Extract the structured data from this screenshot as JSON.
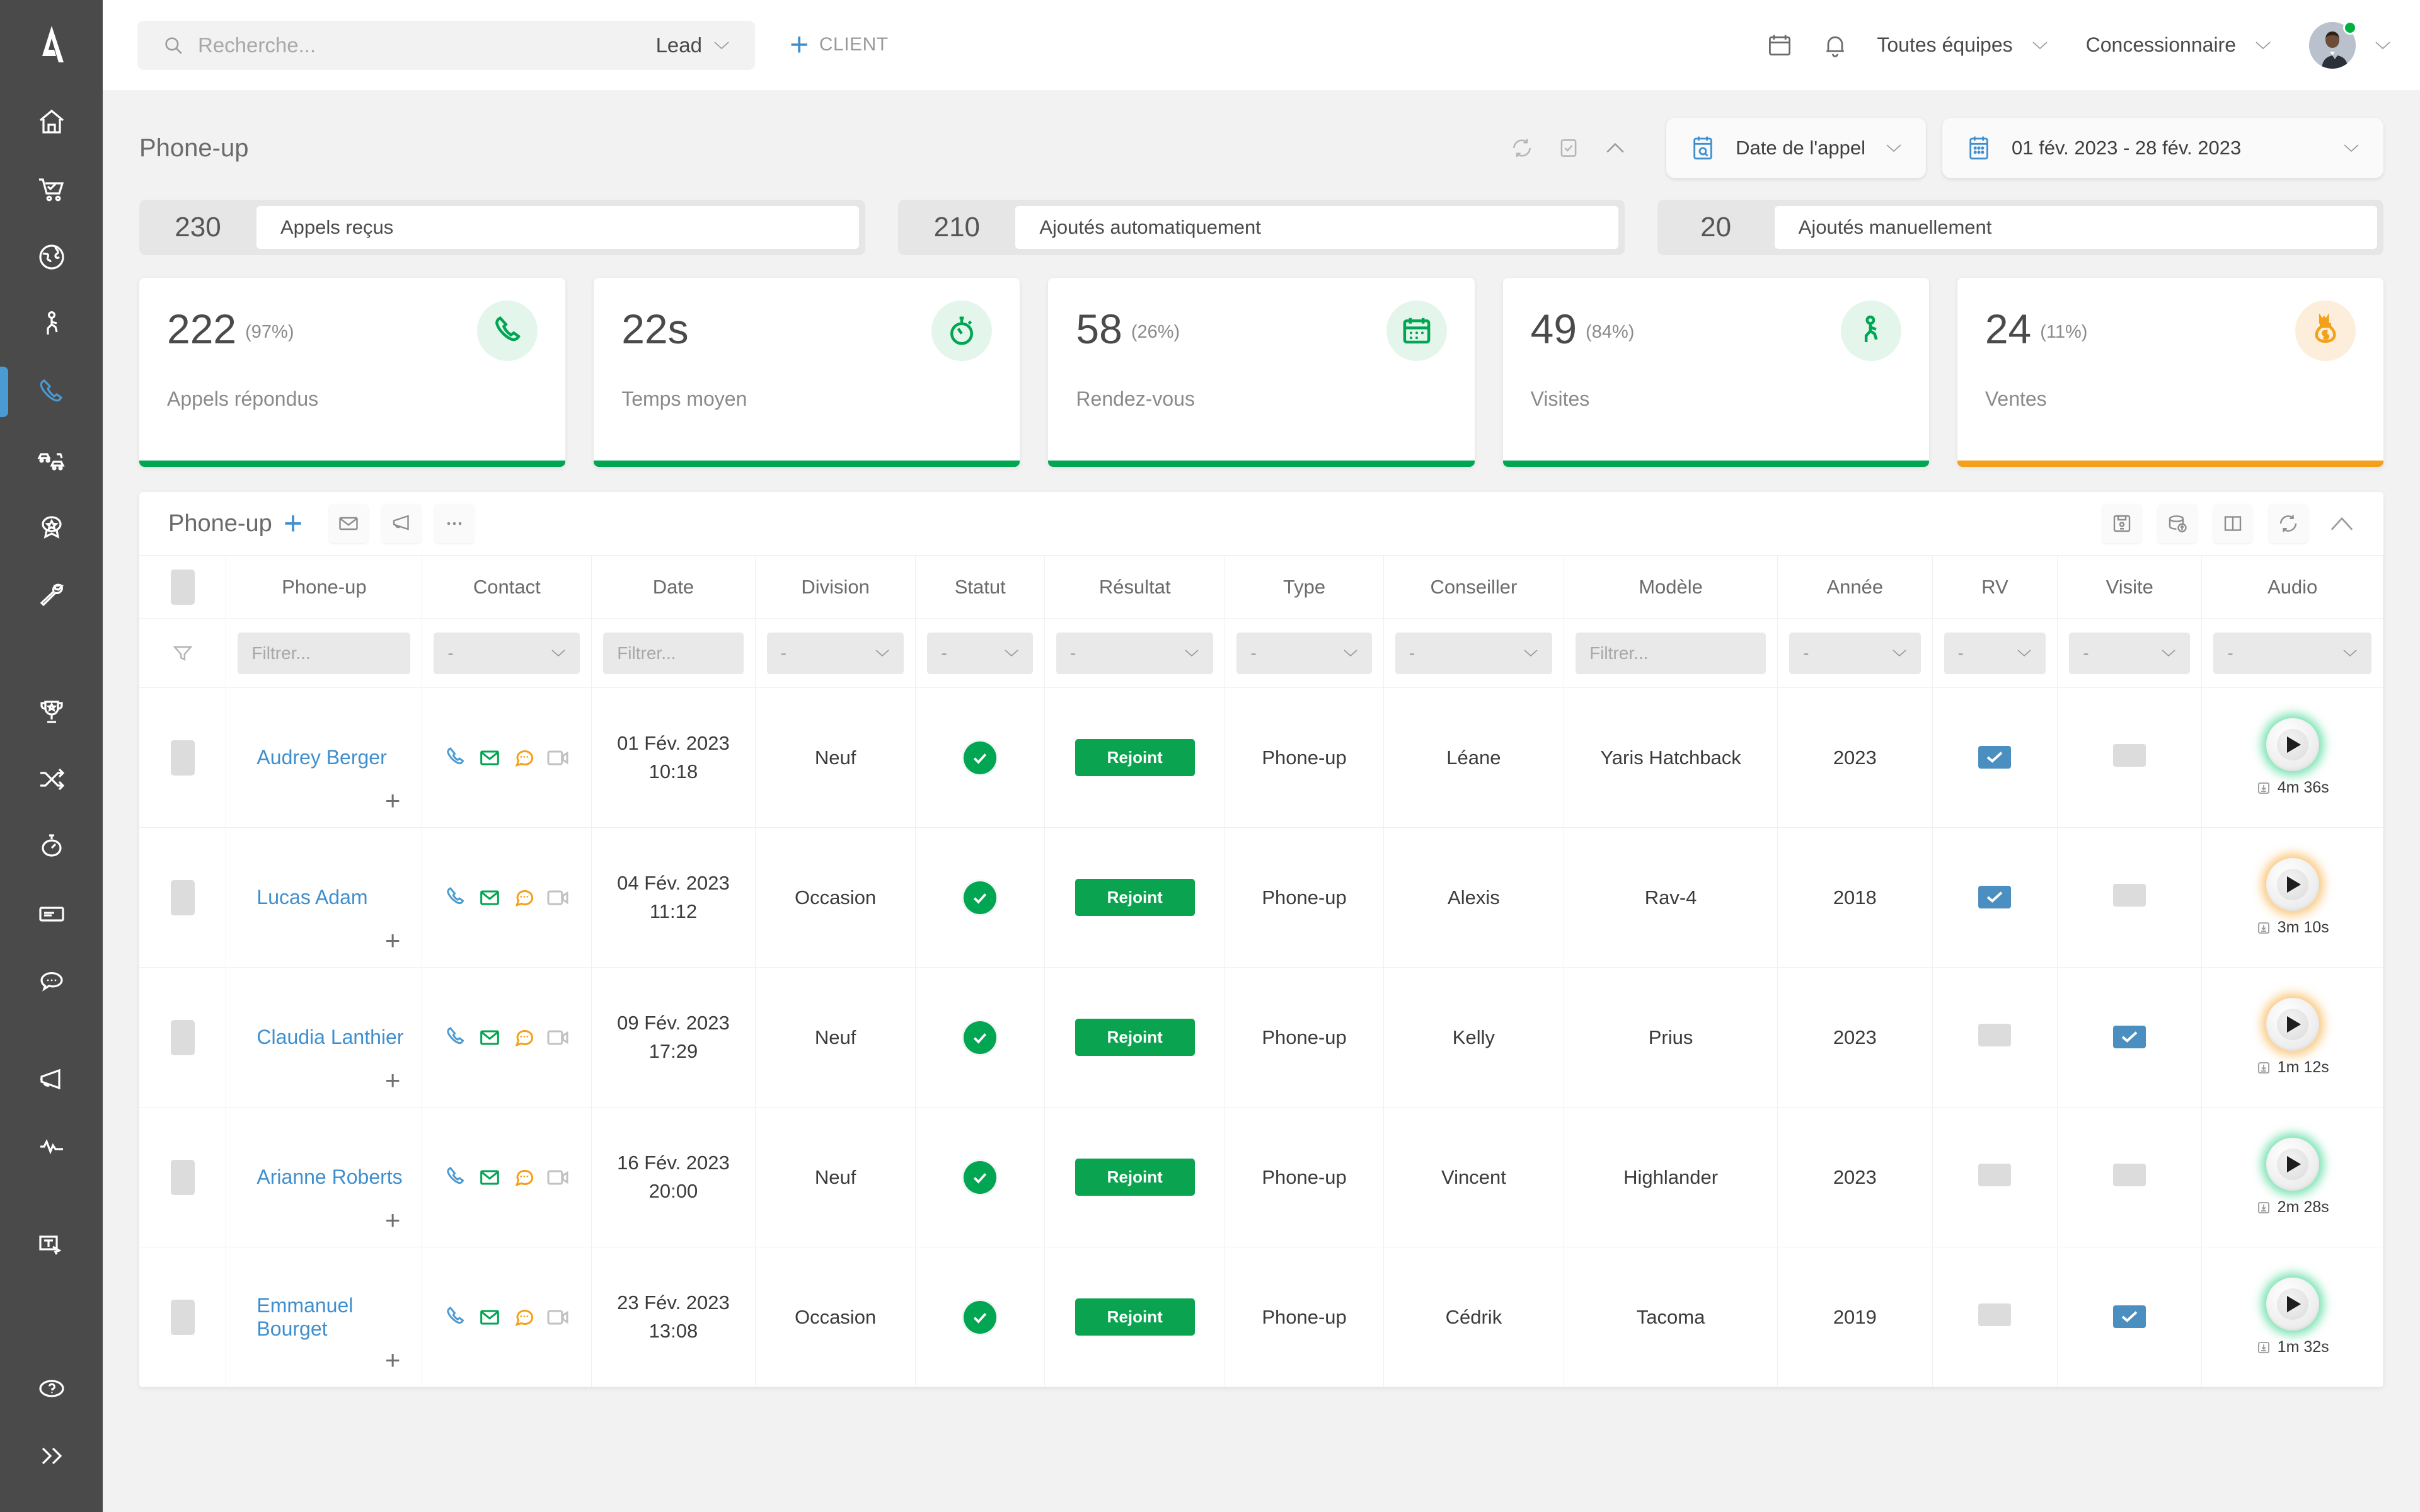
{
  "app": {
    "logo_name": "activix-logo"
  },
  "topbar": {
    "search_placeholder": "Recherche...",
    "search_value": "",
    "lead_selector": "Lead",
    "add_client_label": "CLIENT",
    "team_selector": "Toutes équipes",
    "role_selector": "Concessionnaire"
  },
  "page": {
    "title": "Phone-up",
    "date_filter_label": "Date de l'appel",
    "date_range": "01 fév. 2023 - 28 fév. 2023"
  },
  "counters": [
    {
      "value": "230",
      "label": "Appels reçus"
    },
    {
      "value": "210",
      "label": "Ajoutés automatiquement"
    },
    {
      "value": "20",
      "label": "Ajoutés manuellement"
    }
  ],
  "kpis": [
    {
      "value": "222",
      "pct": "(97%)",
      "label": "Appels répondus",
      "icon": "phone-icon",
      "color": "#00a651"
    },
    {
      "value": "22s",
      "pct": "",
      "label": "Temps moyen",
      "icon": "stopwatch-icon",
      "color": "#00a651"
    },
    {
      "value": "58",
      "pct": "(26%)",
      "label": "Rendez-vous",
      "icon": "calendar-icon",
      "color": "#00a651"
    },
    {
      "value": "49",
      "pct": "(84%)",
      "label": "Visites",
      "icon": "walking-icon",
      "color": "#00a651"
    },
    {
      "value": "24",
      "pct": "(11%)",
      "label": "Ventes",
      "icon": "moneybag-icon",
      "color": "#f3a01a"
    }
  ],
  "panel": {
    "title": "Phone-up",
    "add_label": "+"
  },
  "table": {
    "columns": [
      "Phone-up",
      "Contact",
      "Date",
      "Division",
      "Statut",
      "Résultat",
      "Type",
      "Conseiller",
      "Modèle",
      "Année",
      "RV",
      "Visite",
      "Audio"
    ],
    "filter_placeholder_text": "Filtrer...",
    "filter_placeholder_dash": "-",
    "rows": [
      {
        "name": "Audrey Berger",
        "date": "01 Fév. 2023",
        "time": "10:18",
        "division": "Neuf",
        "statut": "ok",
        "resultat": "Rejoint",
        "type": "Phone-up",
        "conseiller": "Léane",
        "modele": "Yaris Hatchback",
        "annee": "2023",
        "rv": true,
        "visite": false,
        "duration": "4m 36s",
        "audio_ring": "green"
      },
      {
        "name": "Lucas Adam",
        "date": "04 Fév. 2023",
        "time": "11:12",
        "division": "Occasion",
        "statut": "ok",
        "resultat": "Rejoint",
        "type": "Phone-up",
        "conseiller": "Alexis",
        "modele": "Rav-4",
        "annee": "2018",
        "rv": true,
        "visite": false,
        "duration": "3m 10s",
        "audio_ring": "orange"
      },
      {
        "name": "Claudia Lanthier",
        "date": "09 Fév. 2023",
        "time": "17:29",
        "division": "Neuf",
        "statut": "ok",
        "resultat": "Rejoint",
        "type": "Phone-up",
        "conseiller": "Kelly",
        "modele": "Prius",
        "annee": "2023",
        "rv": false,
        "visite": true,
        "duration": "1m 12s",
        "audio_ring": "orange"
      },
      {
        "name": "Arianne Roberts",
        "date": "16 Fév. 2023",
        "time": "20:00",
        "division": "Neuf",
        "statut": "ok",
        "resultat": "Rejoint",
        "type": "Phone-up",
        "conseiller": "Vincent",
        "modele": "Highlander",
        "annee": "2023",
        "rv": false,
        "visite": false,
        "duration": "2m 28s",
        "audio_ring": "green"
      },
      {
        "name": "Emmanuel Bourget",
        "date": "23 Fév. 2023",
        "time": "13:08",
        "division": "Occasion",
        "statut": "ok",
        "resultat": "Rejoint",
        "type": "Phone-up",
        "conseiller": "Cédrik",
        "modele": "Tacoma",
        "annee": "2019",
        "rv": false,
        "visite": true,
        "duration": "1m 32s",
        "audio_ring": "green"
      }
    ]
  },
  "sidebar": {
    "items": [
      {
        "icon": "home-icon",
        "name": "dashboard"
      },
      {
        "icon": "cart-icon",
        "name": "sales"
      },
      {
        "icon": "globe-icon",
        "name": "web"
      },
      {
        "icon": "walking-icon",
        "name": "walk-in"
      },
      {
        "icon": "phone-icon",
        "name": "phone-up"
      },
      {
        "icon": "cars-icon",
        "name": "inventory"
      },
      {
        "icon": "award-icon",
        "name": "service"
      },
      {
        "icon": "wrench-icon",
        "name": "maintenance"
      },
      {
        "icon": "trophy-icon",
        "name": "objectives"
      },
      {
        "icon": "shuffle-icon",
        "name": "flow"
      },
      {
        "icon": "stopwatch-icon",
        "name": "timing"
      },
      {
        "icon": "card-icon",
        "name": "billing"
      },
      {
        "icon": "chat-icon",
        "name": "messages"
      },
      {
        "icon": "megaphone-icon",
        "name": "campaigns"
      },
      {
        "icon": "wave-icon",
        "name": "analytics"
      },
      {
        "icon": "signature-icon",
        "name": "forms"
      },
      {
        "icon": "help-icon",
        "name": "help"
      },
      {
        "icon": "expand-icon",
        "name": "expand"
      }
    ]
  }
}
